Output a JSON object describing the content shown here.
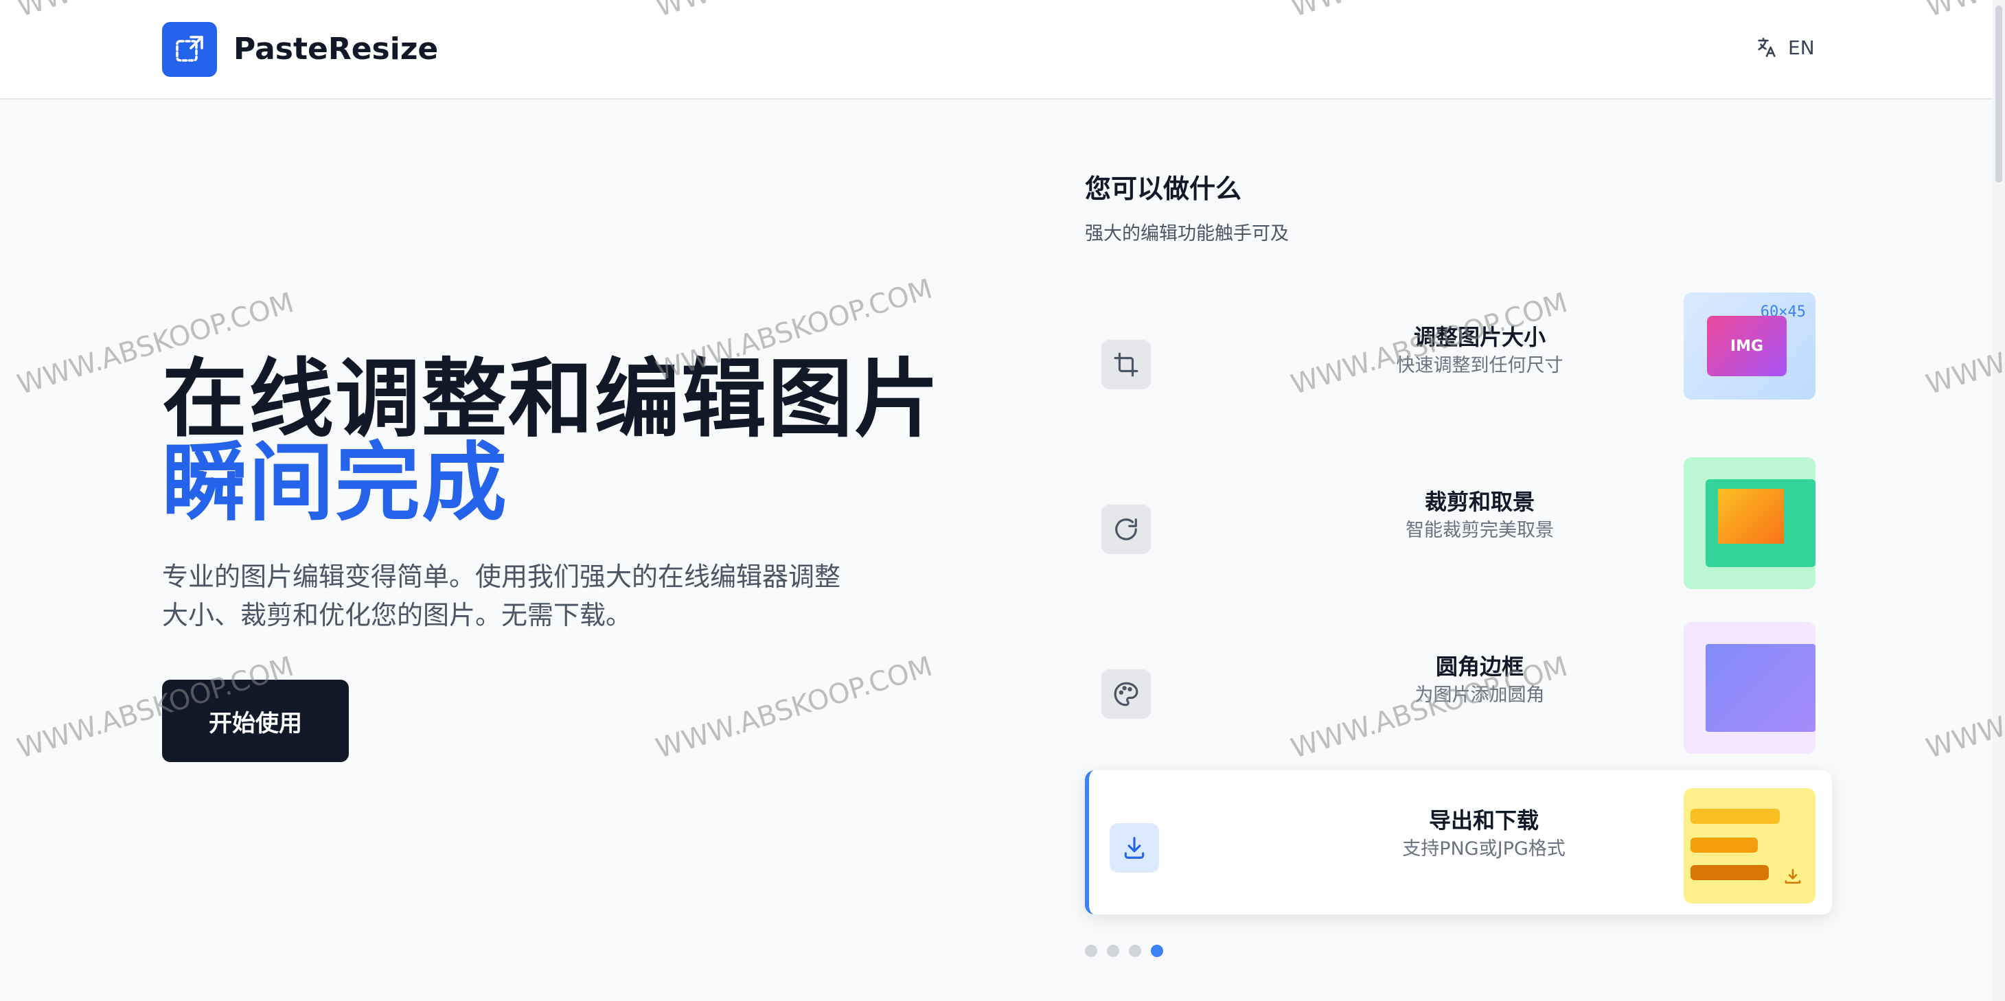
{
  "header": {
    "brand": "PasteResize",
    "lang_label": "EN"
  },
  "hero": {
    "title": "在线调整和编辑图片",
    "accent": "瞬间完成",
    "description": "专业的图片编辑变得简单。使用我们强大的在线编辑器调整大小、裁剪和优化您的图片。无需下载。",
    "cta": "开始使用"
  },
  "features": {
    "title": "您可以做什么",
    "subtitle": "强大的编辑功能触手可及",
    "items": [
      {
        "title": "调整图片大小",
        "subtitle": "快速调整到任何尺寸",
        "icon": "crop-icon",
        "preview_dims": "60×45",
        "preview_tag": "IMG"
      },
      {
        "title": "裁剪和取景",
        "subtitle": "智能裁剪完美取景",
        "icon": "rotate-icon"
      },
      {
        "title": "圆角边框",
        "subtitle": "为图片添加圆角",
        "icon": "palette-icon"
      },
      {
        "title": "导出和下载",
        "subtitle": "支持PNG或JPG格式",
        "icon": "download-icon"
      }
    ],
    "active_index": 3
  },
  "watermark": "WWW.ABSKOOP.COM",
  "colors": {
    "accent": "#2563eb",
    "dark": "#111827",
    "active_border": "#3b82f6"
  }
}
